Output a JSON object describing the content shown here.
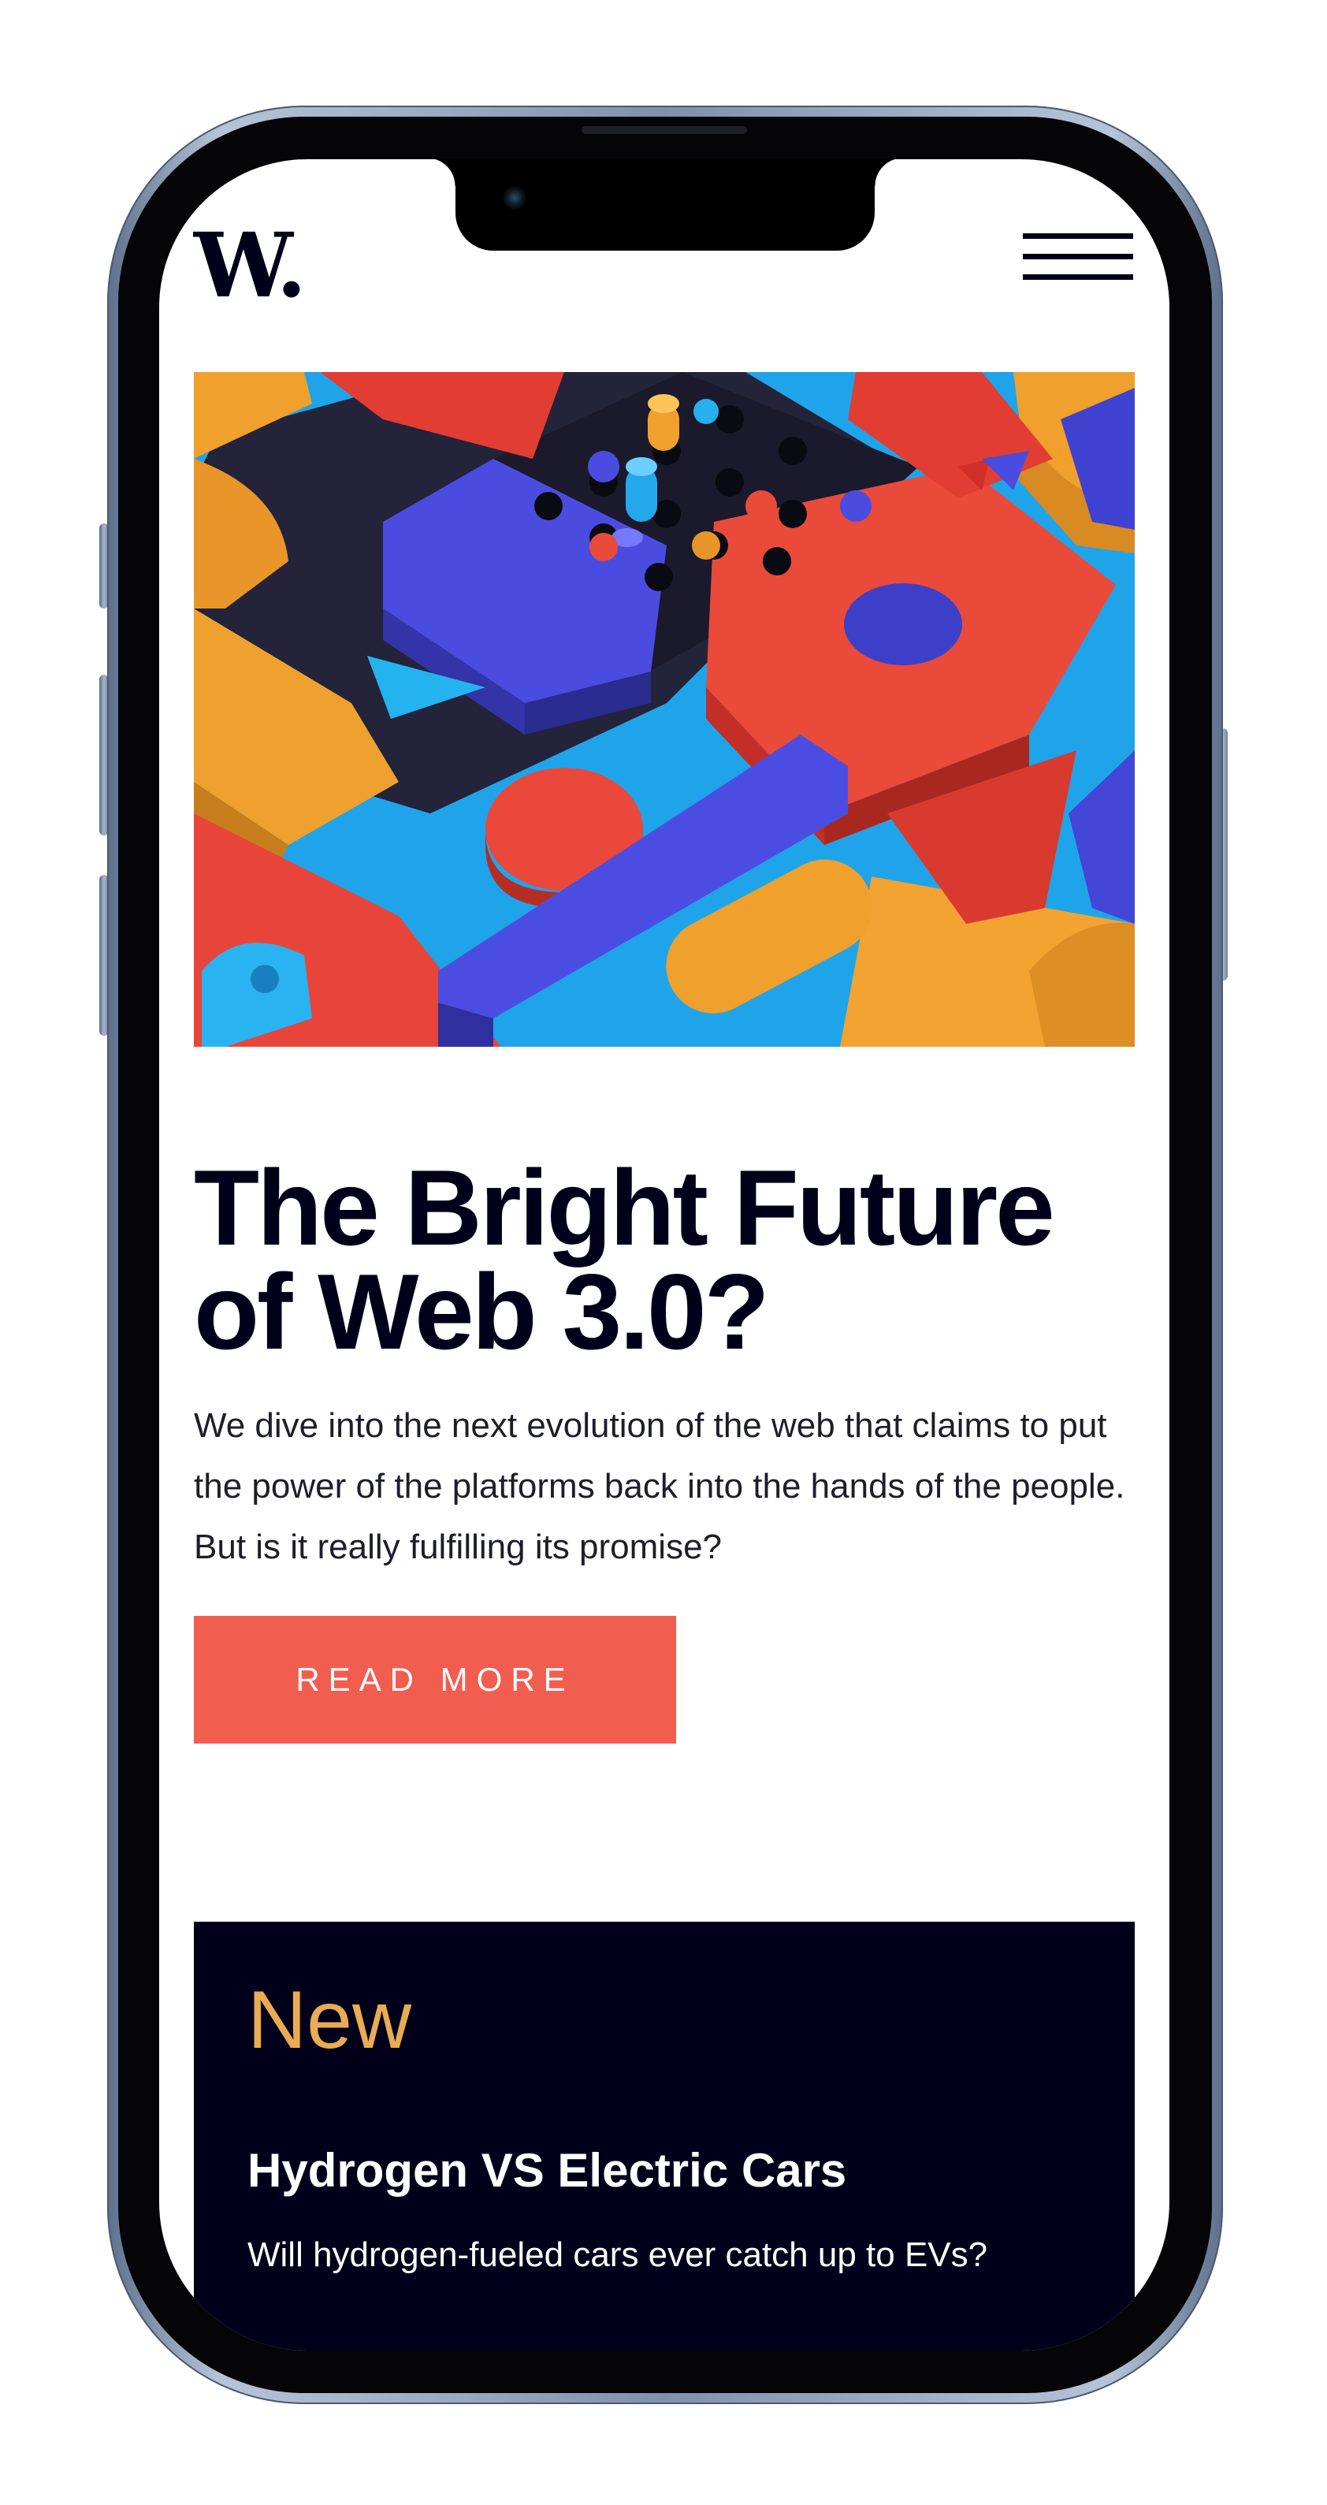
{
  "site": {
    "logo": "W.",
    "menu_icon": "hamburger-menu-icon"
  },
  "hero": {
    "image_alt": "3D geometric blocks illustration",
    "headline": "The Bright Future of Web 3.0?",
    "description": "We dive into the next evolution of the web that claims to put the power of the platforms back into the hands of the people. But is it really fulfilling its promise?",
    "cta_label": "READ MORE"
  },
  "new_section": {
    "title": "New",
    "items": [
      {
        "title": "Hydrogen VS Electric Cars",
        "description": "Will hydrogen-fueled cars ever catch up to EVs?"
      }
    ]
  },
  "colors": {
    "dark_navy": "#00001a",
    "soft_red": "#f15e50",
    "soft_orange": "#e9ab53",
    "white": "#ffffff"
  }
}
